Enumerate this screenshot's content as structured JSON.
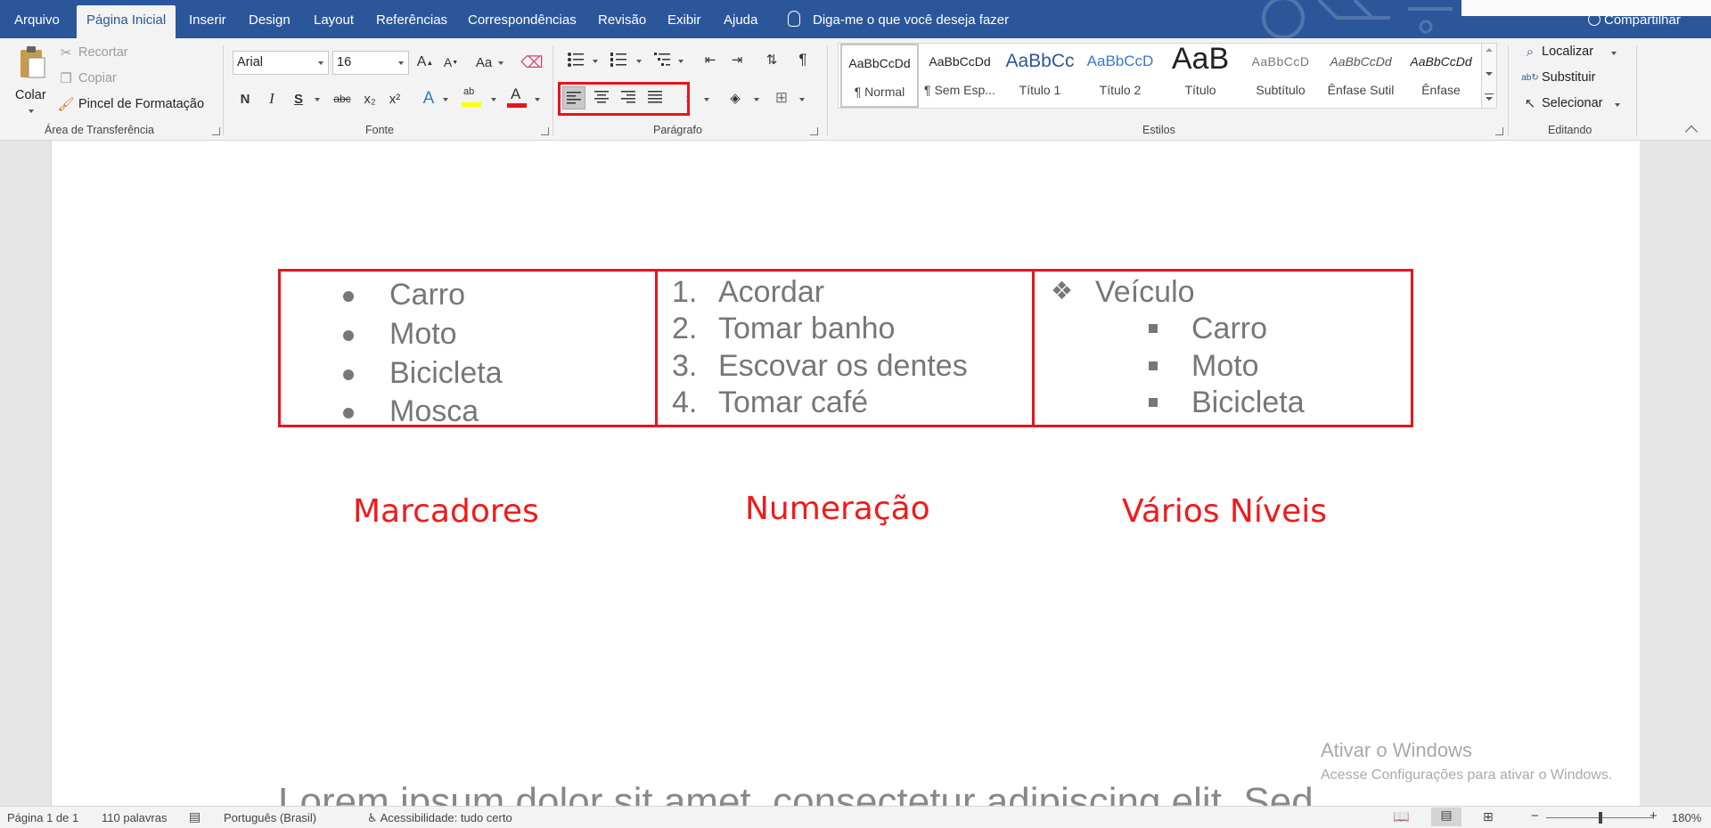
{
  "tabs": [
    "Arquivo",
    "Página Inicial",
    "Inserir",
    "Design",
    "Layout",
    "Referências",
    "Correspondências",
    "Revisão",
    "Exibir",
    "Ajuda"
  ],
  "active_tab": "Página Inicial",
  "tell_me": "Diga-me o que você deseja fazer",
  "share": "Compartilhar",
  "clipboard": {
    "paste": "Colar",
    "cut": "Recortar",
    "copy": "Copiar",
    "format_painter": "Pincel de Formatação",
    "label": "Área de Transferência"
  },
  "font": {
    "name": "Arial",
    "size": "16",
    "case_label": "Aa",
    "bold": "N",
    "italic": "I",
    "underline": "S",
    "strike": "abc",
    "subscript": "x₂",
    "superscript": "x²",
    "label": "Fonte"
  },
  "paragraph": {
    "label": "Parágrafo"
  },
  "styles": {
    "label": "Estilos",
    "items": [
      {
        "sample": "AaBbCcDd",
        "name": "¶ Normal"
      },
      {
        "sample": "AaBbCcDd",
        "name": "¶ Sem Esp..."
      },
      {
        "sample": "AaBbCc",
        "name": "Título 1"
      },
      {
        "sample": "AaBbCcD",
        "name": "Título 2"
      },
      {
        "sample": "AaB",
        "name": "Título"
      },
      {
        "sample": "AaBbCcD",
        "name": "Subtítulo"
      },
      {
        "sample": "AaBbCcDd",
        "name": "Ênfase Sutil"
      },
      {
        "sample": "AaBbCcDd",
        "name": "Ênfase"
      }
    ]
  },
  "editing": {
    "find": "Localizar",
    "replace": "Substituir",
    "select": "Selecionar",
    "label": "Editando"
  },
  "document": {
    "bullets": [
      "Carro",
      "Moto",
      "Bicicleta",
      "Mosca"
    ],
    "numbered": [
      "Acordar",
      "Tomar banho",
      "Escovar os dentes",
      "Tomar café"
    ],
    "numbers": [
      "1.",
      "2.",
      "3.",
      "4."
    ],
    "multilevel_parent": "Veículo",
    "multilevel_children": [
      "Carro",
      "Moto",
      "Bicicleta"
    ],
    "captions": [
      "Marcadores",
      "Numeração",
      "Vários Níveis"
    ],
    "lorem": "Lorem ipsum dolor sit amet, consectetur adipiscing elit. Sed"
  },
  "watermark": {
    "title": "Ativar o Windows",
    "subtitle": "Acesse Configurações para ativar o Windows."
  },
  "status": {
    "page": "Página 1 de 1",
    "words": "110 palavras",
    "language": "Português (Brasil)",
    "accessibility": "Acessibilidade: tudo certo",
    "zoom": "180%"
  }
}
